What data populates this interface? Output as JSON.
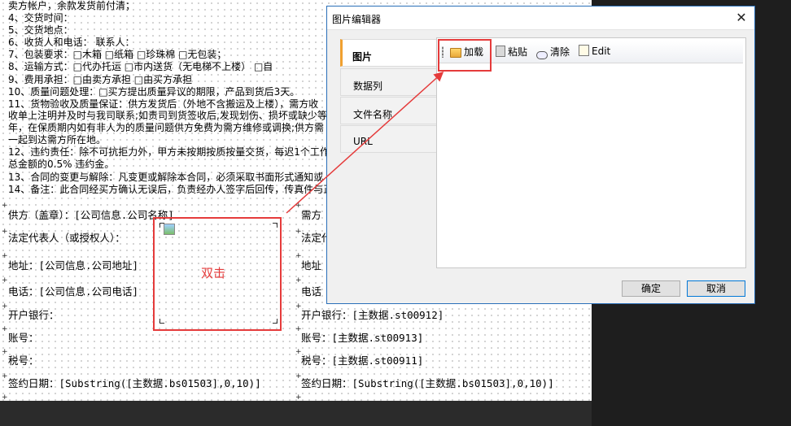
{
  "canvas": {
    "lines": [
      "卖方帐户，余款发货前付清；",
      "4、交货时间：",
      "5、交货地点：",
      "6、收货人和电话：            联系人：",
      "7、包装要求：□木箱    □纸箱    □珍珠棉      □无包装；",
      "8、运输方式：□代办托运        □市内送货（无电梯不上楼）     □自",
      "9、费用承担：□由卖方承担    □由买方承担",
      "10、质量问题处理：□买方提出质量异议的期限，产品到货后3天。",
      "11、货物验收及质量保证：供方发货后（外地不含搬运及上楼），需方收",
      "收单上注明并及时与我司联系;如责司到货签收后,发现划伤、损坏或缺少等",
      "年，在保质期内如有非人为的质量问题供方免费为需方维修或调换;供方需",
      "一起到达需方所在地。",
      "12、违约责任：除不可抗拒力外，甲方未按期按质按量交货，每迟1个工作",
      "总金额的0.5% 违约金。",
      "13、合同的变更与解除：凡变更或解除本合同，必须采取书面形式通知或",
      "14、备注：此合同经买方确认无误后，负责经办人签字后回传，传真件与正"
    ],
    "left_cells": [
      "供方（盖章）：[公司信息.公司名称]",
      "法定代表人（或授权人）：",
      "地址：[公司信息.公司地址]",
      "电话：[公司信息.公司电话]",
      "开户银行：",
      "账号：",
      "税号：",
      "签约日期：[Substring([主数据.bs01503],0,10)]"
    ],
    "right_cells": [
      "需方",
      "法定代",
      "地址",
      "电话",
      "开户银行：[主数据.st00912]",
      "账号：[主数据.st00913]",
      "税号：[主数据.st00911]",
      "签约日期：[Substring([主数据.bs01503],0,10)]"
    ],
    "annotation_label": "双击",
    "accent_color": "#e53b3b"
  },
  "dialog": {
    "title": "图片编辑器",
    "close_glyph": "✕",
    "tabs": [
      "图片",
      "数据列",
      "文件名称",
      "URL"
    ],
    "toolbar": {
      "load": "加载",
      "paste": "粘贴",
      "clear": "清除",
      "edit": "Edit"
    },
    "ok_label": "确定",
    "cancel_label": "取消"
  }
}
